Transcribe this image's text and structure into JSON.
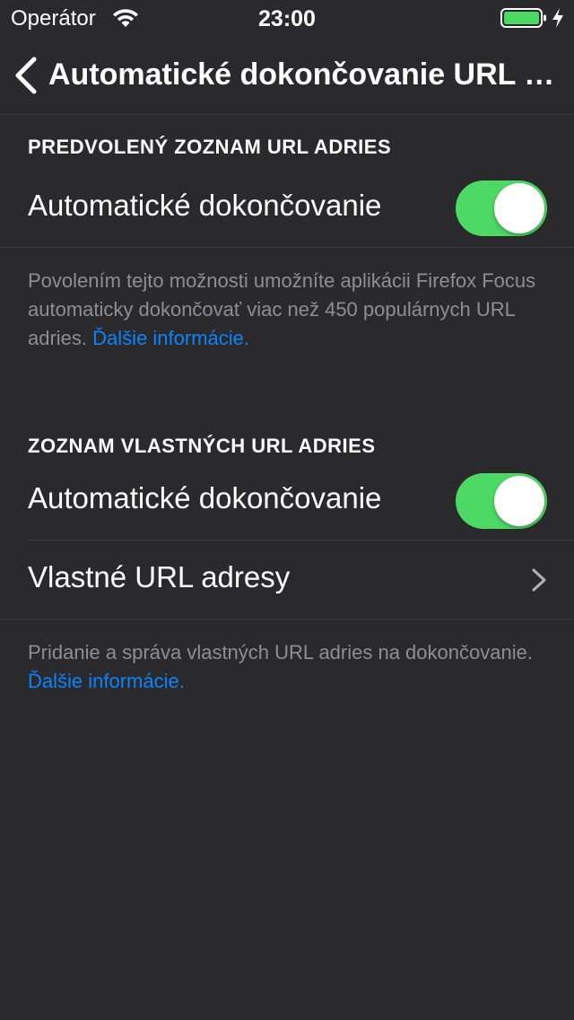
{
  "status_bar": {
    "carrier": "Operátor",
    "time": "23:00"
  },
  "nav": {
    "title": "Automatické dokončovanie URL adries"
  },
  "default_list": {
    "header": "PREDVOLENÝ ZOZNAM URL ADRIES",
    "autocomplete_label": "Automatické dokončovanie",
    "autocomplete_on": true,
    "footer_text": "Povolením tejto možnosti umožníte aplikácii Firefox Focus automaticky dokončovať viac než 450 populárnych URL adries.",
    "footer_link": "Ďalšie informácie."
  },
  "custom_list": {
    "header": "ZOZNAM VLASTNÝCH URL ADRIES",
    "autocomplete_label": "Automatické dokončovanie",
    "autocomplete_on": true,
    "custom_urls_label": "Vlastné URL adresy",
    "footer_text": "Pridanie a správa vlastných URL adries na dokončovanie.",
    "footer_link": "Ďalšie informácie."
  },
  "colors": {
    "background": "#2a2a2c",
    "toggle_on": "#4cd964",
    "link": "#0a84ff",
    "secondary_text": "#8e8e93"
  }
}
